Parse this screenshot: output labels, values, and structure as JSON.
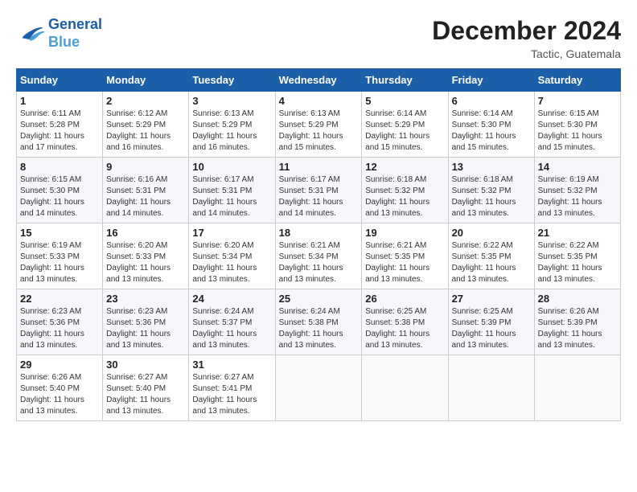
{
  "header": {
    "logo_line1": "General",
    "logo_line2": "Blue",
    "month_title": "December 2024",
    "location": "Tactic, Guatemala"
  },
  "days_of_week": [
    "Sunday",
    "Monday",
    "Tuesday",
    "Wednesday",
    "Thursday",
    "Friday",
    "Saturday"
  ],
  "weeks": [
    [
      {
        "day": "1",
        "info": "Sunrise: 6:11 AM\nSunset: 5:28 PM\nDaylight: 11 hours\nand 17 minutes."
      },
      {
        "day": "2",
        "info": "Sunrise: 6:12 AM\nSunset: 5:29 PM\nDaylight: 11 hours\nand 16 minutes."
      },
      {
        "day": "3",
        "info": "Sunrise: 6:13 AM\nSunset: 5:29 PM\nDaylight: 11 hours\nand 16 minutes."
      },
      {
        "day": "4",
        "info": "Sunrise: 6:13 AM\nSunset: 5:29 PM\nDaylight: 11 hours\nand 15 minutes."
      },
      {
        "day": "5",
        "info": "Sunrise: 6:14 AM\nSunset: 5:29 PM\nDaylight: 11 hours\nand 15 minutes."
      },
      {
        "day": "6",
        "info": "Sunrise: 6:14 AM\nSunset: 5:30 PM\nDaylight: 11 hours\nand 15 minutes."
      },
      {
        "day": "7",
        "info": "Sunrise: 6:15 AM\nSunset: 5:30 PM\nDaylight: 11 hours\nand 15 minutes."
      }
    ],
    [
      {
        "day": "8",
        "info": "Sunrise: 6:15 AM\nSunset: 5:30 PM\nDaylight: 11 hours\nand 14 minutes."
      },
      {
        "day": "9",
        "info": "Sunrise: 6:16 AM\nSunset: 5:31 PM\nDaylight: 11 hours\nand 14 minutes."
      },
      {
        "day": "10",
        "info": "Sunrise: 6:17 AM\nSunset: 5:31 PM\nDaylight: 11 hours\nand 14 minutes."
      },
      {
        "day": "11",
        "info": "Sunrise: 6:17 AM\nSunset: 5:31 PM\nDaylight: 11 hours\nand 14 minutes."
      },
      {
        "day": "12",
        "info": "Sunrise: 6:18 AM\nSunset: 5:32 PM\nDaylight: 11 hours\nand 13 minutes."
      },
      {
        "day": "13",
        "info": "Sunrise: 6:18 AM\nSunset: 5:32 PM\nDaylight: 11 hours\nand 13 minutes."
      },
      {
        "day": "14",
        "info": "Sunrise: 6:19 AM\nSunset: 5:32 PM\nDaylight: 11 hours\nand 13 minutes."
      }
    ],
    [
      {
        "day": "15",
        "info": "Sunrise: 6:19 AM\nSunset: 5:33 PM\nDaylight: 11 hours\nand 13 minutes."
      },
      {
        "day": "16",
        "info": "Sunrise: 6:20 AM\nSunset: 5:33 PM\nDaylight: 11 hours\nand 13 minutes."
      },
      {
        "day": "17",
        "info": "Sunrise: 6:20 AM\nSunset: 5:34 PM\nDaylight: 11 hours\nand 13 minutes."
      },
      {
        "day": "18",
        "info": "Sunrise: 6:21 AM\nSunset: 5:34 PM\nDaylight: 11 hours\nand 13 minutes."
      },
      {
        "day": "19",
        "info": "Sunrise: 6:21 AM\nSunset: 5:35 PM\nDaylight: 11 hours\nand 13 minutes."
      },
      {
        "day": "20",
        "info": "Sunrise: 6:22 AM\nSunset: 5:35 PM\nDaylight: 11 hours\nand 13 minutes."
      },
      {
        "day": "21",
        "info": "Sunrise: 6:22 AM\nSunset: 5:35 PM\nDaylight: 11 hours\nand 13 minutes."
      }
    ],
    [
      {
        "day": "22",
        "info": "Sunrise: 6:23 AM\nSunset: 5:36 PM\nDaylight: 11 hours\nand 13 minutes."
      },
      {
        "day": "23",
        "info": "Sunrise: 6:23 AM\nSunset: 5:36 PM\nDaylight: 11 hours\nand 13 minutes."
      },
      {
        "day": "24",
        "info": "Sunrise: 6:24 AM\nSunset: 5:37 PM\nDaylight: 11 hours\nand 13 minutes."
      },
      {
        "day": "25",
        "info": "Sunrise: 6:24 AM\nSunset: 5:38 PM\nDaylight: 11 hours\nand 13 minutes."
      },
      {
        "day": "26",
        "info": "Sunrise: 6:25 AM\nSunset: 5:38 PM\nDaylight: 11 hours\nand 13 minutes."
      },
      {
        "day": "27",
        "info": "Sunrise: 6:25 AM\nSunset: 5:39 PM\nDaylight: 11 hours\nand 13 minutes."
      },
      {
        "day": "28",
        "info": "Sunrise: 6:26 AM\nSunset: 5:39 PM\nDaylight: 11 hours\nand 13 minutes."
      }
    ],
    [
      {
        "day": "29",
        "info": "Sunrise: 6:26 AM\nSunset: 5:40 PM\nDaylight: 11 hours\nand 13 minutes."
      },
      {
        "day": "30",
        "info": "Sunrise: 6:27 AM\nSunset: 5:40 PM\nDaylight: 11 hours\nand 13 minutes."
      },
      {
        "day": "31",
        "info": "Sunrise: 6:27 AM\nSunset: 5:41 PM\nDaylight: 11 hours\nand 13 minutes."
      },
      {
        "day": "",
        "info": ""
      },
      {
        "day": "",
        "info": ""
      },
      {
        "day": "",
        "info": ""
      },
      {
        "day": "",
        "info": ""
      }
    ]
  ]
}
